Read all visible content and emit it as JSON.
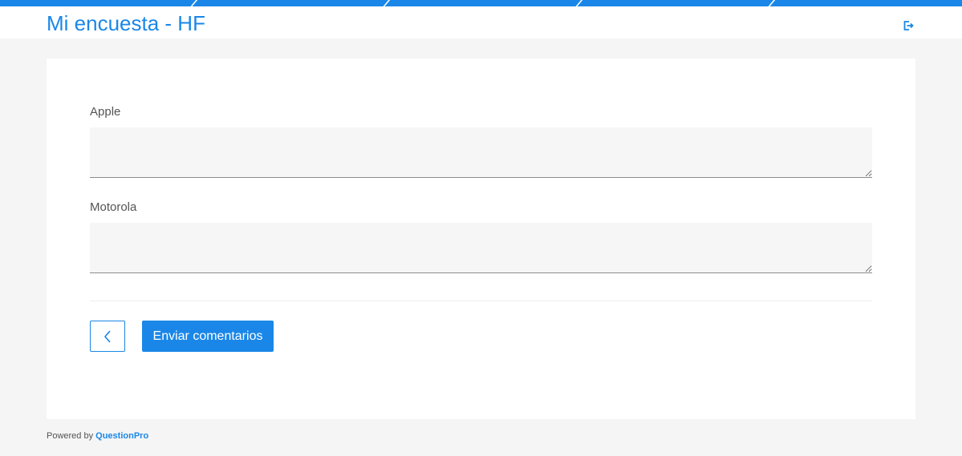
{
  "header": {
    "title": "Mi encuesta - HF",
    "exit_icon": "logout-icon"
  },
  "colors": {
    "accent": "#1a87e8",
    "background": "#f5f5f5",
    "card": "#ffffff",
    "input_background": "#f5f6f5",
    "text": "#545454"
  },
  "questions": [
    {
      "label": "Apple",
      "value": ""
    },
    {
      "label": "Motorola",
      "value": ""
    }
  ],
  "navigation": {
    "back_icon": "chevron-left-icon",
    "submit_label": "Enviar comentarios"
  },
  "footer": {
    "powered_by": "Powered by",
    "brand": "QuestionPro"
  }
}
